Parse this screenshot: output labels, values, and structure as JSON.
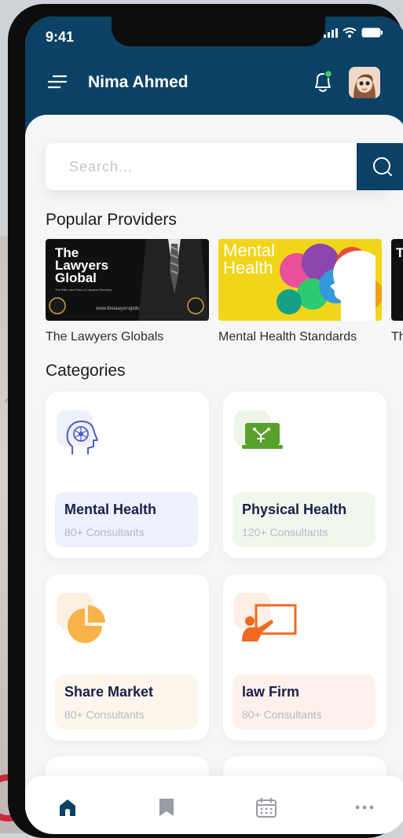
{
  "status": {
    "time": "9:41"
  },
  "header": {
    "user_name": "Nima Ahmed"
  },
  "search": {
    "placeholder": "Search..."
  },
  "popular": {
    "title": "Popular Providers",
    "items": [
      {
        "name": "The Lawyers Globals",
        "image_text": "The Lawyers Global",
        "image_tagline": "The Elite Law Firms & Lawyers Directory",
        "image_url": "www.thelawyersglobal.org"
      },
      {
        "name": "Mental Health Standards",
        "image_text": "Mental Health"
      },
      {
        "name": "Th",
        "image_text": "Th"
      }
    ]
  },
  "categories": {
    "title": "Categories",
    "items": [
      {
        "name": "Mental Health",
        "count": "80+ Consultants",
        "accent": "#4a5fc1",
        "tint": "#eef0fb"
      },
      {
        "name": "Physical Health",
        "count": "120+ Consultants",
        "accent": "#5aa02c",
        "tint": "#f2f7ee"
      },
      {
        "name": "Share Market",
        "count": "80+ Consultants",
        "accent": "#f5a623",
        "tint": "#fdf6ec"
      },
      {
        "name": "law Firm",
        "count": "80+ Consultants",
        "accent": "#ef6a1f",
        "tint": "#fdf1ec"
      }
    ]
  },
  "nav": {
    "items": [
      "home-icon",
      "bookmark-icon",
      "calendar-icon",
      "more-icon"
    ],
    "active": "home-icon"
  },
  "colors": {
    "primary": "#0b4164",
    "background": "#f5f6f8"
  }
}
